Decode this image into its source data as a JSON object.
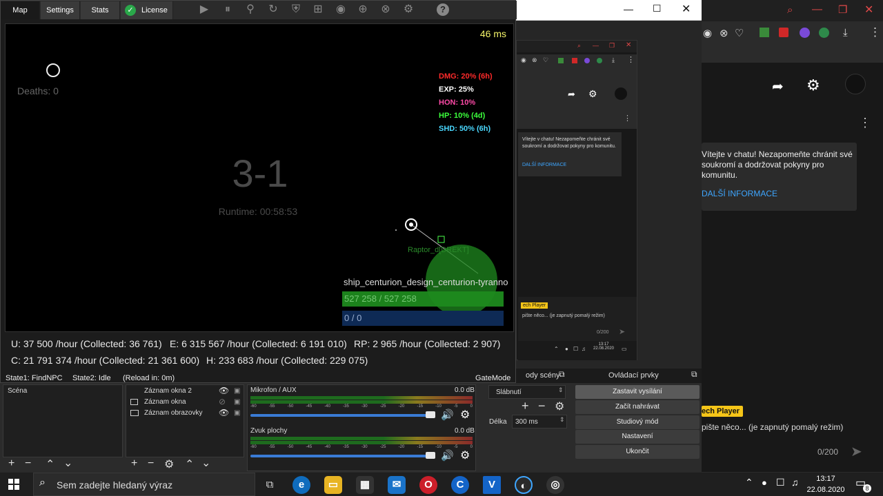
{
  "bot": {
    "tabs": [
      "Map",
      "Settings",
      "Stats",
      "License"
    ],
    "ping": "46 ms",
    "deaths": "Deaths: 0",
    "map_name": "3-1",
    "runtime": "Runtime: 00:58:53",
    "boosters": [
      {
        "text": "DMG: 20% (6h)",
        "color": "#ff2a2a"
      },
      {
        "text": "EXP: 25%",
        "color": "#ffffff"
      },
      {
        "text": "HON: 10%",
        "color": "#ff4aa8"
      },
      {
        "text": "HP: 10% (4d)",
        "color": "#3cff3c"
      },
      {
        "text": "SHD: 50% (6h)",
        "color": "#4ad8ff"
      }
    ],
    "npc_label": "Raptor_d[DREKT]",
    "target_name": "ship_centurion_design_centurion-tyranno",
    "target_hp": "527 258 / 527 258",
    "target_shield": "0 / 0",
    "stats_row1": [
      "U: 37 500 /hour (Collected: 36 761)",
      "E: 6 315 567 /hour (Collected: 6 191 010)",
      "RP: 2 965 /hour (Collected: 2 907)"
    ],
    "stats_row2": [
      "C: 21 791 374 /hour (Collected: 21 361 600)",
      "H: 233 683 /hour (Collected: 229 075)"
    ],
    "state1": "State1: FindNPC",
    "state2": "State2: Idle",
    "reload": "(Reload in: 0m)",
    "mode": "GateMode"
  },
  "obs": {
    "scene": "Scéna",
    "sources": [
      "Záznam okna 2",
      "Záznam okna",
      "Záznam obrazovky"
    ],
    "mixer": [
      {
        "name": "Mikrofon / AUX",
        "db": "0.0 dB"
      },
      {
        "name": "Zvuk plochy",
        "db": "0.0 dB"
      }
    ],
    "meter_ticks": [
      "-60",
      "-55",
      "-50",
      "-45",
      "-40",
      "-35",
      "-30",
      "-25",
      "-20",
      "-15",
      "-10",
      "-5",
      "0"
    ],
    "transitions_title": "ody scény",
    "transition": "Slábnutí",
    "duration_label": "Délka",
    "duration_value": "300 ms",
    "controls_title": "Ovládací prvky",
    "controls": [
      "Zastavit vysílání",
      "Začít nahrávat",
      "Studiový mód",
      "Nastavení",
      "Ukončit"
    ]
  },
  "chat": {
    "welcome_small": "Vítejte v chatu! Nezapomeňte chránit své soukromí a dodržovat pokyny pro komunitu.",
    "more_small": "DALŠÍ INFORMACE",
    "player_small": "ech Player",
    "placeholder_small": "pište něco... (je zapnutý pomalý režim)",
    "counter_small": "0/200",
    "time_small": "13:17",
    "date_small": "22.08.2020",
    "welcome": "Vítejte v chatu! Nezapomeňte chránit své soukromí a dodržovat pokyny pro komunitu.",
    "more": "DALŠÍ INFORMACE",
    "player": "ech Player",
    "placeholder": "pište něco... (je zapnutý pomalý režim)",
    "counter": "0/200"
  },
  "taskbar": {
    "search": "Sem zadejte hledaný výraz",
    "time": "13:17",
    "date": "22.08.2020",
    "notif_count": "8"
  },
  "colors": {
    "obs_blue": "#3a7bd5",
    "hp_green": "#1e8a1e",
    "shield_blue": "#0e2a55",
    "yt_yellow": "#f5c518"
  }
}
